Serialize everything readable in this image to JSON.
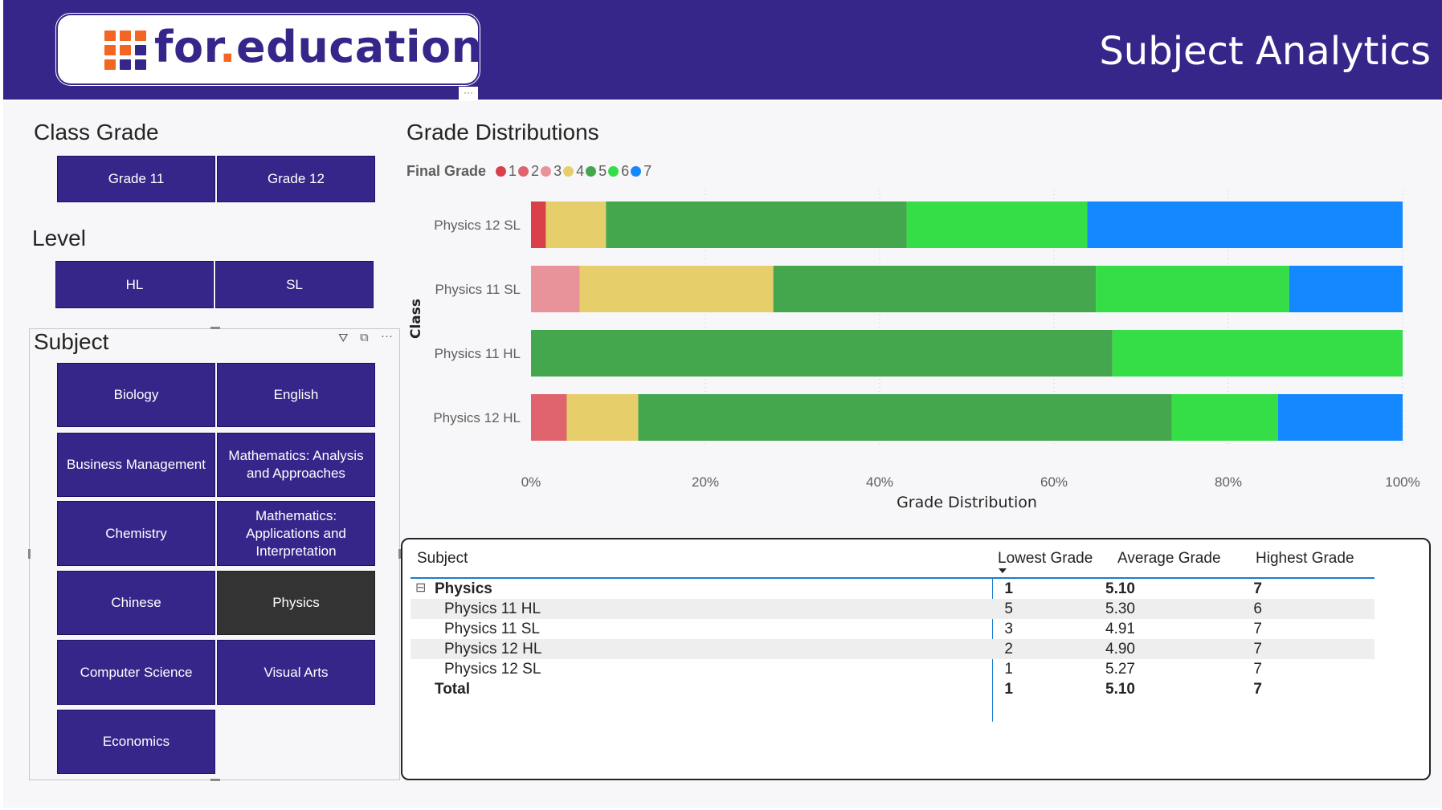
{
  "header": {
    "logo_text_main": "for",
    "logo_text_dot": ".",
    "logo_text_tail": "education",
    "title": "Subject Analytics",
    "more_label": "···",
    "bg_color": "#37268a",
    "accent_color": "#f26522"
  },
  "class_grade": {
    "title": "Class Grade",
    "options": [
      "Grade 11",
      "Grade 12"
    ]
  },
  "level": {
    "title": "Level",
    "options": [
      "HL",
      "SL"
    ]
  },
  "subject": {
    "title": "Subject",
    "icons": [
      "filter-icon",
      "focus-mode-icon",
      "more-options-icon"
    ],
    "options": [
      {
        "label": "Biology",
        "selected": false
      },
      {
        "label": "English",
        "selected": false
      },
      {
        "label": "Business Management",
        "selected": false
      },
      {
        "label": "Mathematics: Analysis and Approaches",
        "selected": false
      },
      {
        "label": "Chemistry",
        "selected": false
      },
      {
        "label": "Mathematics: Applications and Interpretation",
        "selected": false
      },
      {
        "label": "Chinese",
        "selected": false
      },
      {
        "label": "Physics",
        "selected": true
      },
      {
        "label": "Computer Science",
        "selected": false
      },
      {
        "label": "Visual Arts",
        "selected": false
      },
      {
        "label": "Economics",
        "selected": false
      }
    ]
  },
  "chart_data": {
    "type": "bar",
    "orientation": "horizontal",
    "stacked_percent": true,
    "title": "Grade Distributions",
    "legend_title": "Final Grade",
    "legend_position": "top-left",
    "xlabel": "Grade Distribution",
    "ylabel": "Class",
    "xlim": [
      0,
      100
    ],
    "x_ticks": [
      "0%",
      "20%",
      "40%",
      "60%",
      "80%",
      "100%"
    ],
    "grid": true,
    "categories": [
      "Physics 12 SL",
      "Physics 11 SL",
      "Physics 11 HL",
      "Physics 12 HL"
    ],
    "series": [
      {
        "name": "1",
        "color": "#d9404a",
        "values": [
          1.7,
          0,
          0,
          0
        ]
      },
      {
        "name": "2",
        "color": "#e0646e",
        "values": [
          0,
          0,
          0,
          4.1
        ]
      },
      {
        "name": "3",
        "color": "#e8929a",
        "values": [
          0,
          5.6,
          0,
          0
        ]
      },
      {
        "name": "4",
        "color": "#e6cf6a",
        "values": [
          6.9,
          22.2,
          0,
          8.2
        ]
      },
      {
        "name": "5",
        "color": "#44a64d",
        "values": [
          34.5,
          37.0,
          66.7,
          61.2
        ]
      },
      {
        "name": "6",
        "color": "#35dd46",
        "values": [
          20.7,
          22.2,
          33.3,
          12.2
        ]
      },
      {
        "name": "7",
        "color": "#1489ff",
        "values": [
          36.2,
          13.0,
          0,
          14.3
        ]
      }
    ]
  },
  "table": {
    "columns": [
      "Subject",
      "Lowest Grade",
      "Average Grade",
      "Highest Grade"
    ],
    "group": {
      "label": "Physics",
      "lowest": "1",
      "average": "5.10",
      "highest": "7",
      "toggle": "⊟"
    },
    "rows": [
      {
        "label": "Physics 11 HL",
        "lowest": "5",
        "average": "5.30",
        "highest": "6"
      },
      {
        "label": "Physics 11 SL",
        "lowest": "3",
        "average": "4.91",
        "highest": "7"
      },
      {
        "label": "Physics 12 HL",
        "lowest": "2",
        "average": "4.90",
        "highest": "7"
      },
      {
        "label": "Physics 12 SL",
        "lowest": "1",
        "average": "5.27",
        "highest": "7"
      }
    ],
    "total": {
      "label": "Total",
      "lowest": "1",
      "average": "5.10",
      "highest": "7"
    }
  }
}
